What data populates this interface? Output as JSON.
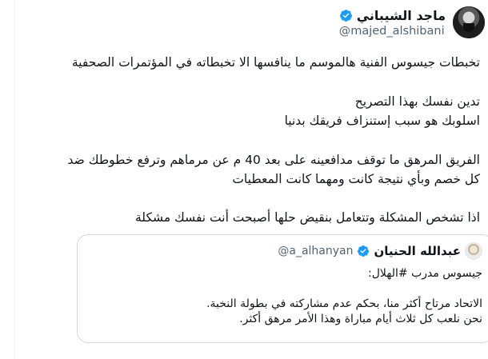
{
  "tweet": {
    "display_name": "ماجد الشيباني",
    "handle": "@majed_alshibani",
    "paragraphs": [
      "تخبطات جيسوس الفنية هالموسم ما ينافسها الا تخبطاته في المؤتمرات الصحفية",
      "تدين نفسك بهذا التصريح",
      "اسلوبك هو سبب إستنزاف فريقك بدنيا",
      "الفريق المرهق ما توقف مدافعينه على بعد 40 م عن مرماهم وترفع خطوطك ضد",
      "كل خصم وبأي نتيجة كانت ومهما كانت المعطيات",
      "اذا تشخص المشكلة وتتعامل بنقيض حلها أصبحت أنت نفسك مشكلة"
    ]
  },
  "quote": {
    "display_name": "عبدالله الحنيان",
    "handle": "@a_alhanyan",
    "lines": [
      "جيسوس مدرب #الهلال:",
      "الاتحاد مرتاح أكثر منا، بحكم عدم مشاركته في بطولة النخبة.",
      "نحن نلعب كل ثلاث أيام مباراة وهذا الأمر مرهق أكثر."
    ]
  },
  "colors": {
    "verified_badge": "#1d9bf0",
    "secondary_text": "#536471",
    "border": "#cfd9de"
  },
  "icons": {
    "verified": "verified-badge-icon"
  }
}
